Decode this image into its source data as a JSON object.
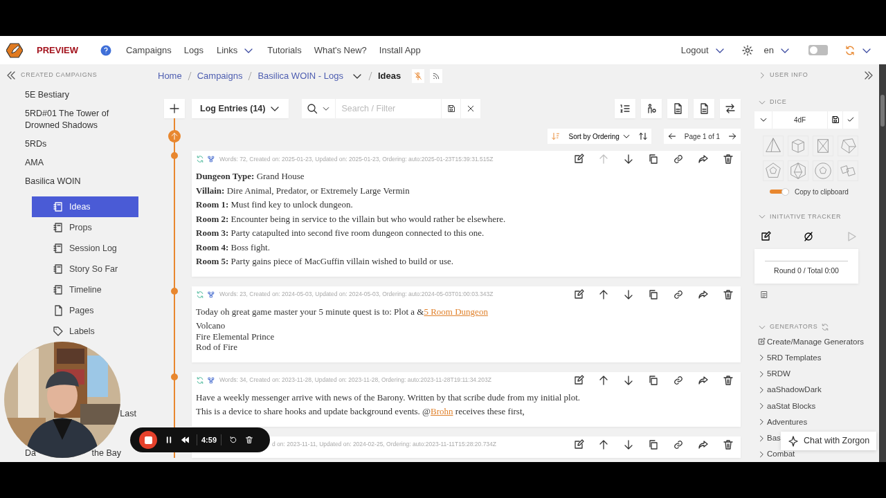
{
  "navbar": {
    "brand": "PREVIEW",
    "links": [
      {
        "label": "Campaigns",
        "dropdown": false
      },
      {
        "label": "Logs",
        "dropdown": false
      },
      {
        "label": "Links",
        "dropdown": true
      },
      {
        "label": "Tutorials",
        "dropdown": false
      },
      {
        "label": "What's New?",
        "dropdown": false
      },
      {
        "label": "Install App",
        "dropdown": false
      }
    ],
    "account": "Logout",
    "language": "en",
    "theme_switch": {
      "on": false
    }
  },
  "left_sidebar": {
    "heading": "CREATED CAMPAIGNS",
    "campaigns": [
      {
        "label": "5E Bestiary"
      },
      {
        "label": "5RD#01 The Tower of Drowned Shadows"
      },
      {
        "label": "5RDs"
      },
      {
        "label": "AMA"
      },
      {
        "label": "Basilica WOIN",
        "children": [
          {
            "label": "Ideas",
            "kind": "log",
            "selected": true
          },
          {
            "label": "Props",
            "kind": "log",
            "selected": false
          },
          {
            "label": "Session Log",
            "kind": "log",
            "selected": false
          },
          {
            "label": "Story So Far",
            "kind": "log",
            "selected": false
          },
          {
            "label": "Timeline",
            "kind": "log",
            "selected": false
          },
          {
            "label": "Pages",
            "kind": "pages",
            "selected": false
          },
          {
            "label": "Labels",
            "kind": "labels",
            "selected": false
          }
        ]
      }
    ],
    "covered_items": [
      {
        "fragments": [
          "Last"
        ]
      },
      {
        "fragments": [
          "Da",
          "the Bay"
        ]
      }
    ]
  },
  "breadcrumb": [
    {
      "label": "Home",
      "current": false,
      "dropdown": false
    },
    {
      "label": "Campaigns",
      "current": false,
      "dropdown": false
    },
    {
      "label": "Basilica WOIN - Logs",
      "current": false,
      "dropdown": true
    },
    {
      "label": "Ideas",
      "current": true,
      "dropdown": false
    }
  ],
  "toolbar": {
    "log_selector": "Log Entries (14)",
    "search": {
      "placeholder": "Search / Filter"
    }
  },
  "sorting": {
    "sort_by": "Sort by Ordering",
    "page": "Page 1 of 1"
  },
  "entries": [
    {
      "kind": "entry",
      "can_move_up": false,
      "meta": "Words: 72, Created on: 2025-01-23, Updated on: 2025-01-23, Ordering: auto:2025-01-23T15:39:31.515Z",
      "paragraphs": [
        [
          [
            {
              "text": "**Dungeon Type:** Grand House"
            }
          ]
        ],
        [
          [
            {
              "text": "**Villain:** Dire Animal, Predator, or Extremely Large Vermin"
            }
          ]
        ],
        [
          [
            {
              "text": "**Room 1:** Must find key to unlock dungeon."
            }
          ]
        ],
        [
          [
            {
              "text": "**Room 2:** Encounter being in service to the villain but who would rather be elsewhere."
            }
          ]
        ],
        [
          [
            {
              "text": "**Room 3:** Party catapulted into second five room dungeon connected to this one."
            }
          ]
        ],
        [
          [
            {
              "text": "**Room 4:** Boss fight."
            }
          ]
        ],
        [
          [
            {
              "text": "**Room 5:** Party gains piece of MacGuffin villain wished to build or use."
            }
          ]
        ]
      ]
    },
    {
      "kind": "entry",
      "can_move_up": true,
      "meta": "Words: 23, Created on: 2024-05-03, Updated on: 2024-05-03, Ordering: auto:2024-05-03T01:00:03.343Z",
      "paragraphs": [
        [
          [
            {
              "text": "Today oh great game master your 5 minute quest is to: Plot a &"
            },
            {
              "link": "5 Room Dungeon"
            }
          ]
        ],
        [
          [
            {
              "text": "Volcano"
            }
          ],
          [
            {
              "text": "Fire Elemental Prince"
            }
          ],
          [
            {
              "text": "Rod of Fire"
            }
          ]
        ]
      ]
    },
    {
      "kind": "entry",
      "can_move_up": true,
      "meta": "Words: 34, Created on: 2023-11-28, Updated on: 2023-11-28, Ordering: auto:2023-11-28T19:11:34.203Z",
      "paragraphs": [
        [
          [
            {
              "text": "Have a weekly messenger arrive with news of the Barony. Written by that scribe dude from my initial plot."
            }
          ]
        ],
        [
          [
            {
              "text": "This is a device to share hooks and update background events. @"
            },
            {
              "link": "Brohn"
            },
            {
              "text": " receives these first,"
            }
          ]
        ]
      ]
    },
    {
      "kind": "covered",
      "can_move_up": true,
      "meta": "d on: 2023-11-11, Updated on: 2024-02-25, Ordering: auto:2023-11-11T15:28:20.734Z"
    }
  ],
  "right_panel": {
    "user_info": {
      "title": "USER INFO",
      "expanded": false
    },
    "dice": {
      "title": "DICE",
      "expanded": true,
      "formula": "4dF",
      "copy_to_clipboard": {
        "label": "Copy to clipboard",
        "on": true
      }
    },
    "initiative": {
      "title": "INITIATIVE TRACKER",
      "expanded": true,
      "summary": "Round 0 / Total 0:00"
    },
    "generators": {
      "title": "GENERATORS",
      "expanded": true,
      "manage": "Create/Manage Generators",
      "items": [
        {
          "label": "5RD Templates"
        },
        {
          "label": "5RDW"
        },
        {
          "label": "aaShadowDark"
        },
        {
          "label": "aaStat Blocks"
        },
        {
          "label": "Adventures"
        },
        {
          "label": "Bas"
        },
        {
          "label": "Combat"
        }
      ]
    }
  },
  "chat_button": "Chat with Zorgon",
  "recording": {
    "time": "4:59"
  }
}
